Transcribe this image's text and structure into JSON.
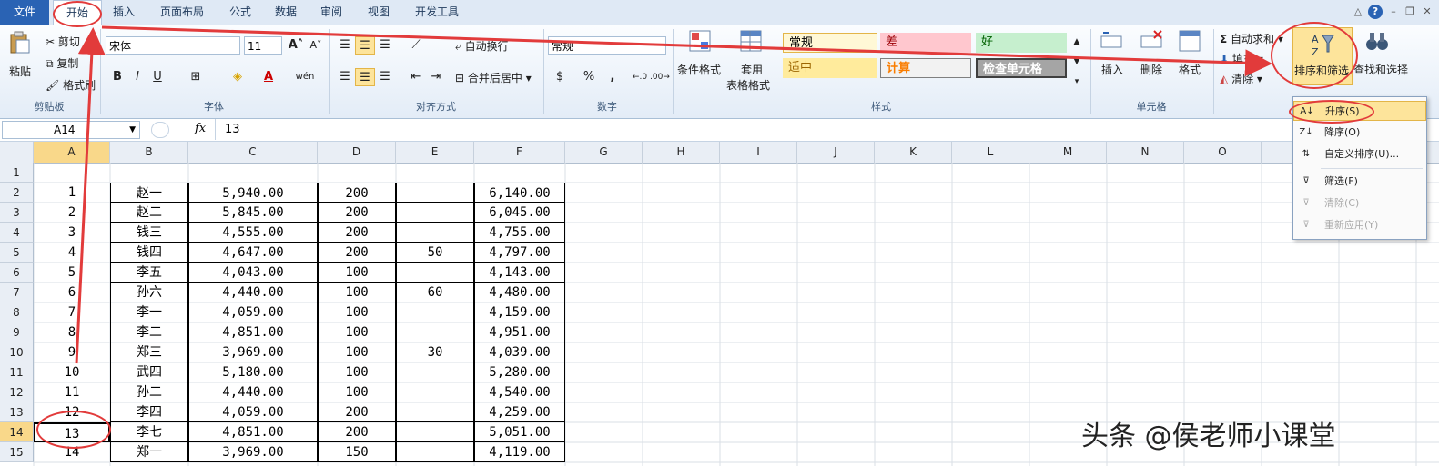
{
  "tabs": [
    "文件",
    "开始",
    "插入",
    "页面布局",
    "公式",
    "数据",
    "审阅",
    "视图",
    "开发工具"
  ],
  "clipboard": {
    "paste": "粘贴",
    "cut": "剪切",
    "copy": "复制",
    "painter": "格式刷",
    "label": "剪贴板"
  },
  "font": {
    "name": "宋体",
    "size": "11",
    "bold": "B",
    "italic": "I",
    "underline": "U",
    "label": "字体",
    "phonetic": "wén"
  },
  "alignment": {
    "wrap": "自动换行",
    "merge": "合并后居中",
    "label": "对齐方式"
  },
  "number": {
    "format": "常规",
    "percent": "%",
    "comma": ",",
    "label": "数字"
  },
  "styles": {
    "cond": "条件格式",
    "table_a": "套用",
    "table_b": "表格格式",
    "normal": "常规",
    "bad": "差",
    "good": "好",
    "neutral": "适中",
    "calc": "计算",
    "check": "检查单元格",
    "label": "样式"
  },
  "cells": {
    "insert": "插入",
    "delete": "删除",
    "format": "格式",
    "label": "单元格"
  },
  "editing": {
    "autosum": "自动求和",
    "fill": "填充",
    "clear": "清除",
    "sort": "排序和筛选",
    "find": "查找和选择"
  },
  "formula_bar": {
    "name_box": "A14",
    "fx": "fx",
    "value": "13"
  },
  "columns": [
    "A",
    "B",
    "C",
    "D",
    "E",
    "F",
    "G",
    "H",
    "I",
    "J",
    "K",
    "L",
    "M",
    "N",
    "O"
  ],
  "rows": [
    {
      "n": "1",
      "a": "",
      "b": "",
      "c": "",
      "d": "",
      "e": "",
      "f": ""
    },
    {
      "n": "2",
      "a": "1",
      "b": "赵一",
      "c": "5,940.00",
      "d": "200",
      "e": "",
      "f": "6,140.00"
    },
    {
      "n": "3",
      "a": "2",
      "b": "赵二",
      "c": "5,845.00",
      "d": "200",
      "e": "",
      "f": "6,045.00"
    },
    {
      "n": "4",
      "a": "3",
      "b": "钱三",
      "c": "4,555.00",
      "d": "200",
      "e": "",
      "f": "4,755.00"
    },
    {
      "n": "5",
      "a": "4",
      "b": "钱四",
      "c": "4,647.00",
      "d": "200",
      "e": "50",
      "f": "4,797.00"
    },
    {
      "n": "6",
      "a": "5",
      "b": "李五",
      "c": "4,043.00",
      "d": "100",
      "e": "",
      "f": "4,143.00"
    },
    {
      "n": "7",
      "a": "6",
      "b": "孙六",
      "c": "4,440.00",
      "d": "100",
      "e": "60",
      "f": "4,480.00"
    },
    {
      "n": "8",
      "a": "7",
      "b": "李一",
      "c": "4,059.00",
      "d": "100",
      "e": "",
      "f": "4,159.00"
    },
    {
      "n": "9",
      "a": "8",
      "b": "李二",
      "c": "4,851.00",
      "d": "100",
      "e": "",
      "f": "4,951.00"
    },
    {
      "n": "10",
      "a": "9",
      "b": "郑三",
      "c": "3,969.00",
      "d": "100",
      "e": "30",
      "f": "4,039.00"
    },
    {
      "n": "11",
      "a": "10",
      "b": "武四",
      "c": "5,180.00",
      "d": "100",
      "e": "",
      "f": "5,280.00"
    },
    {
      "n": "12",
      "a": "11",
      "b": "孙二",
      "c": "4,440.00",
      "d": "100",
      "e": "",
      "f": "4,540.00"
    },
    {
      "n": "13",
      "a": "12",
      "b": "李四",
      "c": "4,059.00",
      "d": "200",
      "e": "",
      "f": "4,259.00"
    },
    {
      "n": "14",
      "a": "13",
      "b": "李七",
      "c": "4,851.00",
      "d": "200",
      "e": "",
      "f": "5,051.00"
    },
    {
      "n": "15",
      "a": "14",
      "b": "郑一",
      "c": "3,969.00",
      "d": "150",
      "e": "",
      "f": "4,119.00"
    }
  ],
  "sort_menu": [
    {
      "label": "升序(S)",
      "enabled": true
    },
    {
      "label": "降序(O)",
      "enabled": true
    },
    {
      "label": "自定义排序(U)...",
      "enabled": true
    },
    {
      "label": "筛选(F)",
      "enabled": true
    },
    {
      "label": "清除(C)",
      "enabled": false
    },
    {
      "label": "重新应用(Y)",
      "enabled": false
    }
  ],
  "watermark": "头条 @侯老师小课堂",
  "colors": {
    "accent": "#2a63b4",
    "annotation": "#e23b3b",
    "selected": "#fde49b"
  }
}
